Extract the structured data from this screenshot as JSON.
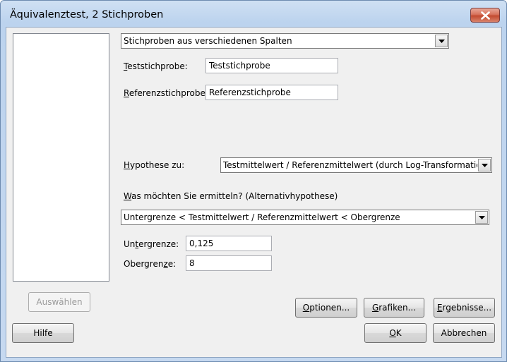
{
  "window": {
    "title": "Äquivalenztest, 2 Stichproben"
  },
  "sample_mode": {
    "value": "Stichproben aus verschiedenen Spalten"
  },
  "test_sample": {
    "label_ul": "T",
    "label_rest": "eststichprobe:",
    "value": "Teststichprobe"
  },
  "reference_sample": {
    "label_ul": "R",
    "label_rest": "eferenzstichprobe:",
    "value": "Referenzstichprobe"
  },
  "hypothesis": {
    "label_ul": "H",
    "label_rest": "ypothese zu:",
    "value": "Testmittelwert / Referenzmittelwert (durch Log-Transformation"
  },
  "alternative": {
    "label_ul": "W",
    "label_rest": "as möchten Sie ermitteln? (Alternativhypothese)",
    "value": "Untergrenze < Testmittelwert / Referenzmittelwert < Obergrenze"
  },
  "lower_bound": {
    "label_pre": "Un",
    "label_ul": "t",
    "label_rest": "ergrenze:",
    "value": "0,125"
  },
  "upper_bound": {
    "label_pre": "Obergren",
    "label_ul": "z",
    "label_rest": "e:",
    "value": "8"
  },
  "buttons": {
    "select": "Auswählen",
    "help": "Hilfe",
    "options_ul": "O",
    "options_rest": "ptionen...",
    "graphics_ul": "G",
    "graphics_rest": "rafiken...",
    "results_ul": "E",
    "results_rest": "rgebnisse...",
    "ok_ul": "O",
    "ok_rest": "K",
    "cancel": "Abbrechen"
  }
}
